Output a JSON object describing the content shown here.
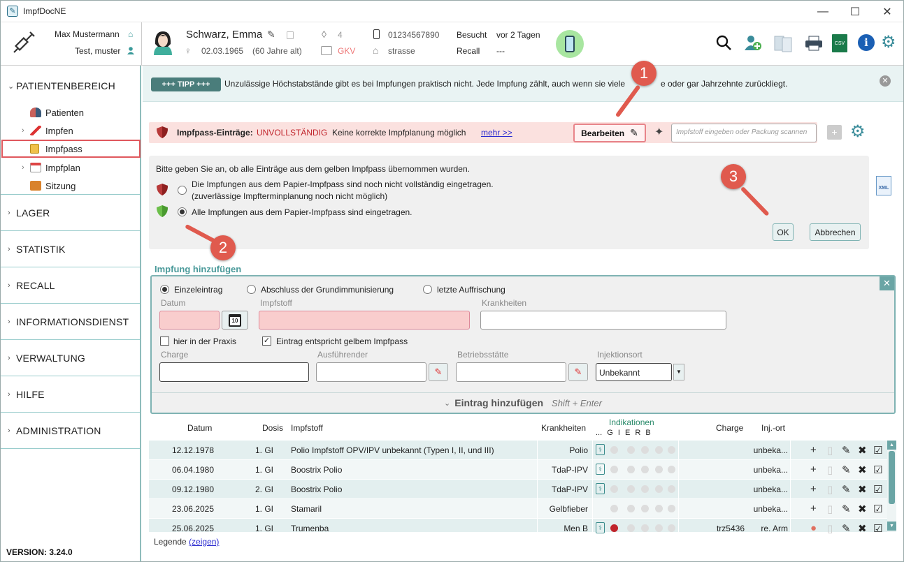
{
  "window": {
    "title": "ImpfDocNE"
  },
  "header": {
    "user_name": "Max Mustermann",
    "user_role": "Test, muster",
    "patient_name": "Schwarz, Emma",
    "birth": "02.03.1965",
    "age": "(60 Jahre alt)",
    "tag_count": "4",
    "insurance": "GKV",
    "phone": "01234567890",
    "street": "strasse",
    "visit_label": "Besucht",
    "visit_value": "vor 2 Tagen",
    "recall_label": "Recall",
    "recall_value": "---"
  },
  "sidebar": {
    "sections": [
      "PATIENTENBEREICH",
      "LAGER",
      "STATISTIK",
      "RECALL",
      "INFORMATIONSDIENST",
      "VERWALTUNG",
      "HILFE",
      "ADMINISTRATION"
    ],
    "items": [
      "Patienten",
      "Impfen",
      "Impfpass",
      "Impfplan",
      "Sitzung"
    ],
    "version": "VERSION: 3.24.0"
  },
  "tip": {
    "badge": "+++ TIPP +++",
    "text": "Unzulässige Höchstabstände gibt es bei Impfungen praktisch nicht. Jede Impfung zählt, auch wenn sie viele",
    "text_end": "e oder gar Jahrzehnte zurückliegt."
  },
  "warning": {
    "label": "Impfpass-Einträge:",
    "status": "UNVOLLSTÄNDIG",
    "text": "Keine korrekte Impfplanung möglich",
    "link": "mehr >>",
    "edit_button": "Bearbeiten",
    "search_placeholder": "Impfstoff eingeben oder Packung scannen"
  },
  "dialog": {
    "prompt": "Bitte geben Sie an, ob alle Einträge aus dem gelben Impfpass übernommen wurden.",
    "option1_line1": "Die Impfungen aus dem Papier-Impfpass sind noch nicht vollständig eingetragen.",
    "option1_line2": "(zuverlässige Impfterminplanung noch nicht möglich)",
    "option2": "Alle Impfungen aus dem Papier-Impfpass sind eingetragen.",
    "ok": "OK",
    "cancel": "Abbrechen"
  },
  "callouts": [
    "1",
    "2",
    "3"
  ],
  "add": {
    "title": "Impfung hinzufügen",
    "mode1": "Einzeleintrag",
    "mode2": "Abschluss der Grundimmunisierung",
    "mode3": "letzte Auffrischung",
    "datum": "Datum",
    "impfstoff": "Impfstoff",
    "krankheiten": "Krankheiten",
    "praxis": "hier in der Praxis",
    "gelb": "Eintrag entspricht gelbem Impfpass",
    "charge": "Charge",
    "ausf": "Ausführender",
    "betrieb": "Betriebsstätte",
    "injort": "Injektionsort",
    "injort_value": "Unbekannt",
    "submit": "Eintrag hinzufügen",
    "shortcut": "Shift + Enter",
    "calendar_day": "10"
  },
  "table": {
    "headers": {
      "datum": "Datum",
      "dosis": "Dosis",
      "impfstoff": "Impfstoff",
      "krankheiten": "Krankheiten",
      "indikationen": "Indikationen",
      "ind_letters": "... G I E R B",
      "charge": "Charge",
      "injort": "Inj.-ort"
    },
    "rows": [
      {
        "datum": "12.12.1978",
        "dosis": "1. GI",
        "impfstoff": "Polio Impfstoff OPV/IPV unbekannt (Typen I, II, und III)",
        "krankheiten": "Polio",
        "charge": "",
        "injort": "unbeka..."
      },
      {
        "datum": "06.04.1980",
        "dosis": "1. GI",
        "impfstoff": "Boostrix Polio",
        "krankheiten": "TdaP-IPV",
        "charge": "",
        "injort": "unbeka..."
      },
      {
        "datum": "09.12.1980",
        "dosis": "2. GI",
        "impfstoff": "Boostrix Polio",
        "krankheiten": "TdaP-IPV",
        "charge": "",
        "injort": "unbeka..."
      },
      {
        "datum": "23.06.2025",
        "dosis": "1. GI",
        "impfstoff": "Stamaril",
        "krankheiten": "Gelbfieber",
        "charge": "",
        "injort": "unbeka..."
      },
      {
        "datum": "25.06.2025",
        "dosis": "1. GI",
        "impfstoff": "Trumenba",
        "krankheiten": "Men B",
        "charge": "trz5436",
        "injort": "re. Arm"
      }
    ]
  },
  "legend": {
    "label": "Legende",
    "link": "(zeigen)"
  }
}
